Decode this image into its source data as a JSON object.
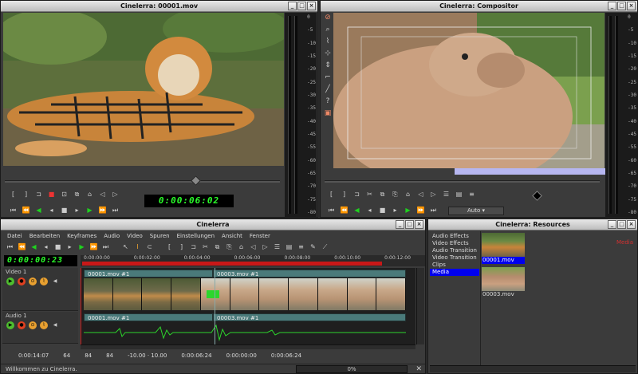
{
  "viewer": {
    "title": "Cinelerra: 00001.mov",
    "timecode": "0:00:06:02",
    "meter_ticks": [
      "0",
      "-5",
      "-10",
      "-15",
      "-20",
      "-25",
      "-30",
      "-35",
      "-40",
      "-45",
      "-55",
      "-60",
      "-65",
      "-70",
      "-75",
      "-80"
    ]
  },
  "compositor": {
    "title": "Cinelerra: Compositor",
    "zoom": "Auto",
    "tools": [
      "protect-icon",
      "zoom-icon",
      "mask-icon",
      "camera-icon",
      "projector-icon",
      "crop-icon",
      "eyedrop-icon",
      "help-icon",
      "safe-region-icon"
    ]
  },
  "main": {
    "title": "Cinelerra",
    "menu": [
      "Datei",
      "Bearbeiten",
      "Keyframes",
      "Audio",
      "Video",
      "Spuren",
      "Einstellungen",
      "Ansicht",
      "Fenster"
    ],
    "timecode": "0:00:00:23",
    "ruler": [
      "0:00:00:00",
      "0:00:02:00",
      "0:00:04:00",
      "0:00:06:00",
      "0:00:08:00",
      "0:00:10:00",
      "0:00:12:00"
    ],
    "tracks": [
      {
        "name": "Video 1",
        "clips": [
          "00001.mov #1",
          "00003.mov #1"
        ]
      },
      {
        "name": "Audio 1",
        "clips": [
          "00001.mov #1",
          "00003.mov #1"
        ]
      }
    ],
    "bottom": {
      "pos": "0:00:14:07",
      "sample_zoom": "64",
      "amp_zoom": "84",
      "track_zoom": "84",
      "curve": "-10.00 · 10.00",
      "sel_start": "0:00:06:24",
      "sel_len": "0:00:00:00",
      "sel_end": "0:00:06:24"
    },
    "status": "Willkommen zu Cinelerra.",
    "progress": "0%"
  },
  "resources": {
    "title": "Cinelerra: Resources",
    "folders": [
      "Audio Effects",
      "Video Effects",
      "Audio Transition",
      "Video Transition",
      "Clips",
      "Media"
    ],
    "selected_folder": "Media",
    "items": [
      {
        "label": "00001.mov"
      },
      {
        "label": "00003.mov"
      }
    ],
    "media_label": "Media"
  },
  "colors": {
    "lcd": "#2aff2a",
    "selection": "#0000ee",
    "media_red": "#d03030"
  }
}
